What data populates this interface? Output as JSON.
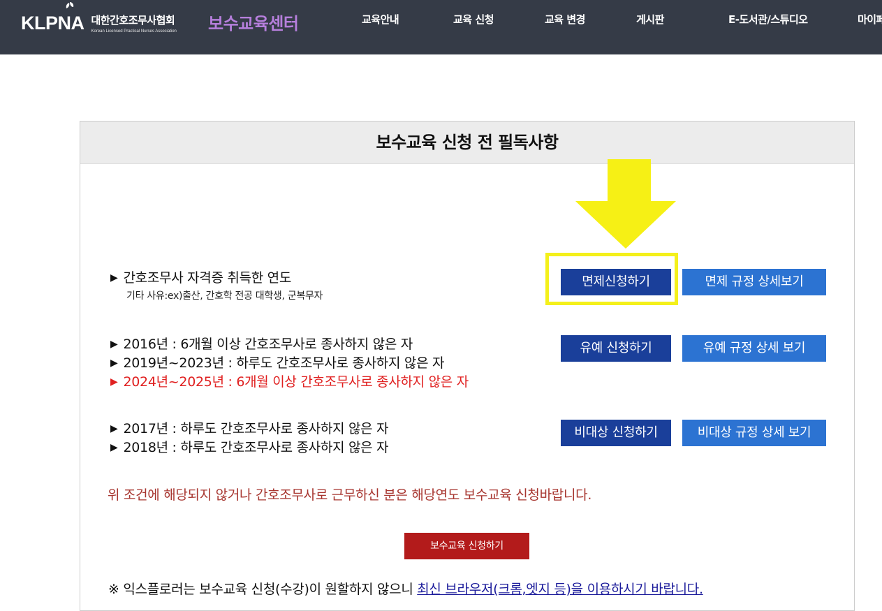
{
  "header": {
    "logo_text": "KLPNA",
    "org_name_kr": "대한간호조무사협회",
    "org_name_en": "Korean Licensed Practical Nurses Association",
    "site_title": "보수교육센터",
    "nav": [
      "교육안내",
      "교육 신청",
      "교육 변경",
      "게시판",
      "E-도서관/스튜디오",
      "마이페"
    ]
  },
  "panel": {
    "title": "보수교육 신청 전 필독사항",
    "sections": [
      {
        "lines": [
          "간호조무사 자격증 취득한 연도"
        ],
        "sub": "기타 사유:ex)출산, 간호학 전공 대학생, 군복무자",
        "apply_label": "면제신청하기",
        "rules_label": "면제 규정 상세보기"
      },
      {
        "lines": [
          "2016년 : 6개월 이상 간호조무사로 종사하지 않은 자",
          "2019년~2023년 : 하루도 간호조무사로 종사하지 않은 자",
          "2024년~2025년 : 6개월 이상 간호조무사로 종사하지 않은 자"
        ],
        "apply_label": "유예 신청하기",
        "rules_label": "유예 규정 상세 보기"
      },
      {
        "lines": [
          "2017년 : 하루도 간호조무사로 종사하지 않은 자",
          "2018년 : 하루도 간호조무사로 종사하지 않은 자"
        ],
        "apply_label": "비대상 신청하기",
        "rules_label": "비대상 규정 상세 보기"
      }
    ],
    "notice": "위 조건에 해당되지 않거나 간호조무사로 근무하신 분은 해당연도 보수교육 신청바랍니다.",
    "main_button": "보수교육 신청하기",
    "footnote_prefix": "※ 익스플로러는 보수교육 신청(수강)이 원할하지 않으니 ",
    "footnote_link": "최신 브라우저(크롬,엣지 등)을 이용하시기 바랍니다."
  },
  "bullet_icon": "triangle-right",
  "colors": {
    "header_bg": "#353b47",
    "site_title": "#b67fdc",
    "btn_dark": "#1a3f9a",
    "btn_light": "#2c73d2",
    "btn_red": "#b31b1b",
    "highlight": "#f4f01b",
    "warning_text": "#e02020",
    "notice_text": "#a7352f"
  }
}
